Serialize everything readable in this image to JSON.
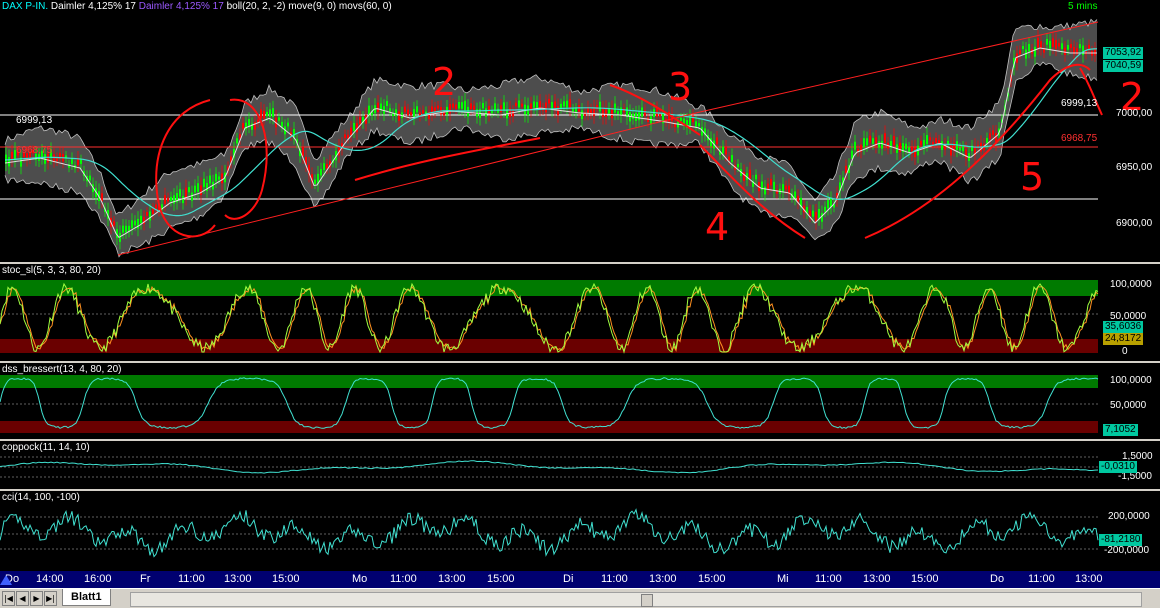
{
  "header": {
    "symbol": "DAX P-IN.",
    "items": [
      {
        "text": "Daimler",
        "color": "#ffffff"
      },
      {
        "text": "4,125% 17",
        "color": "#ffffff"
      },
      {
        "text": "Daimler  4,125% 17",
        "color": "#9b59ff"
      },
      {
        "text": "boll(20, 2, -2)",
        "color": "#ffffff"
      },
      {
        "text": "move(9, 0)",
        "color": "#ffffff"
      },
      {
        "text": "movs(60, 0)",
        "color": "#ffffff"
      }
    ],
    "interval": "5 mins"
  },
  "main": {
    "price_tags": [
      {
        "text": "7053,92",
        "bg": "#00c8a0",
        "color": "#000000"
      },
      {
        "text": "7040,59",
        "bg": "#00c8a0",
        "color": "#000000"
      },
      {
        "text": "6999,13",
        "bg": "#000000",
        "color": "#ffffff"
      },
      {
        "text": "6968,75",
        "bg": "#000000",
        "color": "#ff3030"
      }
    ],
    "left_labels": [
      {
        "text": "6999,13",
        "color": "#ffffff"
      },
      {
        "text": "6968,75",
        "color": "#ff3030"
      }
    ],
    "axis": [
      "7000,00",
      "6950,00",
      "6900,00"
    ],
    "annotations": [
      "2",
      "3",
      "4",
      "5",
      "2"
    ]
  },
  "stoc": {
    "label": "stoc_sl(5, 3, 3, 80, 20)",
    "axis": [
      "100,0000",
      "50,0000",
      "0"
    ],
    "tags": [
      "35,6036",
      "24,8172"
    ]
  },
  "dss": {
    "label": "dss_bressert(13, 4, 80, 20)",
    "axis": [
      "100,0000",
      "50,0000",
      "0"
    ],
    "tag": "7,1052"
  },
  "coppock": {
    "label": "coppock(11, 14, 10)",
    "axis": [
      "1,5000",
      "-1,5000"
    ],
    "tag": "-0,0310"
  },
  "cci": {
    "label": "cci(14, 100, -100)",
    "axis": [
      "200,0000",
      "-200,0000"
    ],
    "tag": "-81,2180"
  },
  "xaxis": [
    "Do",
    "14:00",
    "16:00",
    "Fr",
    "11:00",
    "13:00",
    "15:00",
    "Mo",
    "11:00",
    "13:00",
    "15:00",
    "Di",
    "11:00",
    "13:00",
    "15:00",
    "Mi",
    "11:00",
    "13:00",
    "15:00",
    "Do",
    "11:00",
    "13:00"
  ],
  "statusbar": {
    "sheet": "Blatt1",
    "nav": [
      "|◀",
      "◀",
      "▶",
      "▶|"
    ]
  },
  "colors": {
    "bg": "#000000",
    "band": "#5a5a5a",
    "candle_up": "#00ff00",
    "candle_down": "#ff0000",
    "ma": "#40e0d0",
    "annotation": "#ff1010",
    "overbought": "#007a00",
    "oversold": "#6a0000"
  }
}
